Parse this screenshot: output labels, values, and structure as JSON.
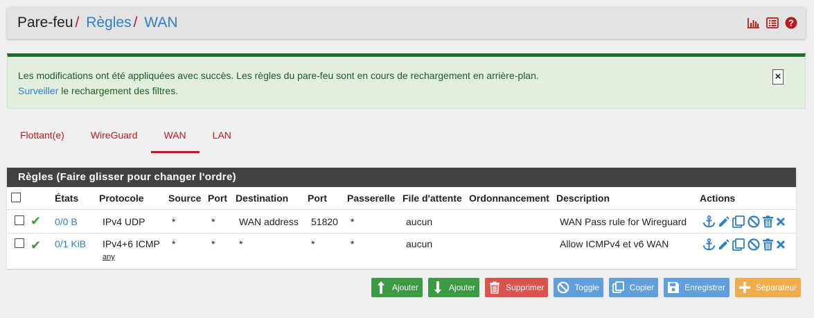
{
  "breadcrumb": {
    "items": [
      "Pare-feu",
      "Règles",
      "WAN"
    ],
    "separator": "/"
  },
  "header_icons": [
    "chart-icon",
    "list-icon",
    "help-icon"
  ],
  "alert": {
    "line1": "Les modifications ont été appliquées avec succès. Les règles du pare-feu sont en cours de rechargement en arrière-plan.",
    "link": "Surveiller",
    "line2_rest": " le rechargement des filtres.",
    "close": "×"
  },
  "tabs": [
    {
      "label": "Flottant(e)",
      "active": false
    },
    {
      "label": "WireGuard",
      "active": false
    },
    {
      "label": "WAN",
      "active": true
    },
    {
      "label": "LAN",
      "active": false
    }
  ],
  "panel": {
    "title": "Règles (Faire glisser pour changer l'ordre)",
    "columns": [
      "",
      "",
      "États",
      "Protocole",
      "Source",
      "Port",
      "Destination",
      "Port",
      "Passerelle",
      "File d'attente",
      "Ordonnancement",
      "Description",
      "Actions"
    ],
    "rows": [
      {
        "states": "0/0 B",
        "protocol": "IPv4 UDP",
        "protocol_sub": "",
        "source": "*",
        "source_port": "*",
        "destination": "WAN address",
        "dest_port": "51820",
        "gateway": "*",
        "queue": "aucun",
        "schedule": "",
        "description": "WAN Pass rule for Wireguard"
      },
      {
        "states": "0/1 KiB",
        "protocol": "IPv4+6 ICMP",
        "protocol_sub": "any",
        "source": "*",
        "source_port": "*",
        "destination": "*",
        "dest_port": "*",
        "gateway": "*",
        "queue": "aucun",
        "schedule": "",
        "description": "Allow ICMPv4 et v6 WAN"
      }
    ]
  },
  "buttons": {
    "add_top": "Ajouter",
    "add_bottom": "Ajouter",
    "delete": "Supprimer",
    "toggle": "Toggle",
    "copy": "Copier",
    "save": "Enregistrer",
    "separator": "Séparateur"
  },
  "colors": {
    "accent_red": "#b71c1c",
    "link_blue": "#2f7fc3",
    "success_green": "#3c9a44"
  }
}
